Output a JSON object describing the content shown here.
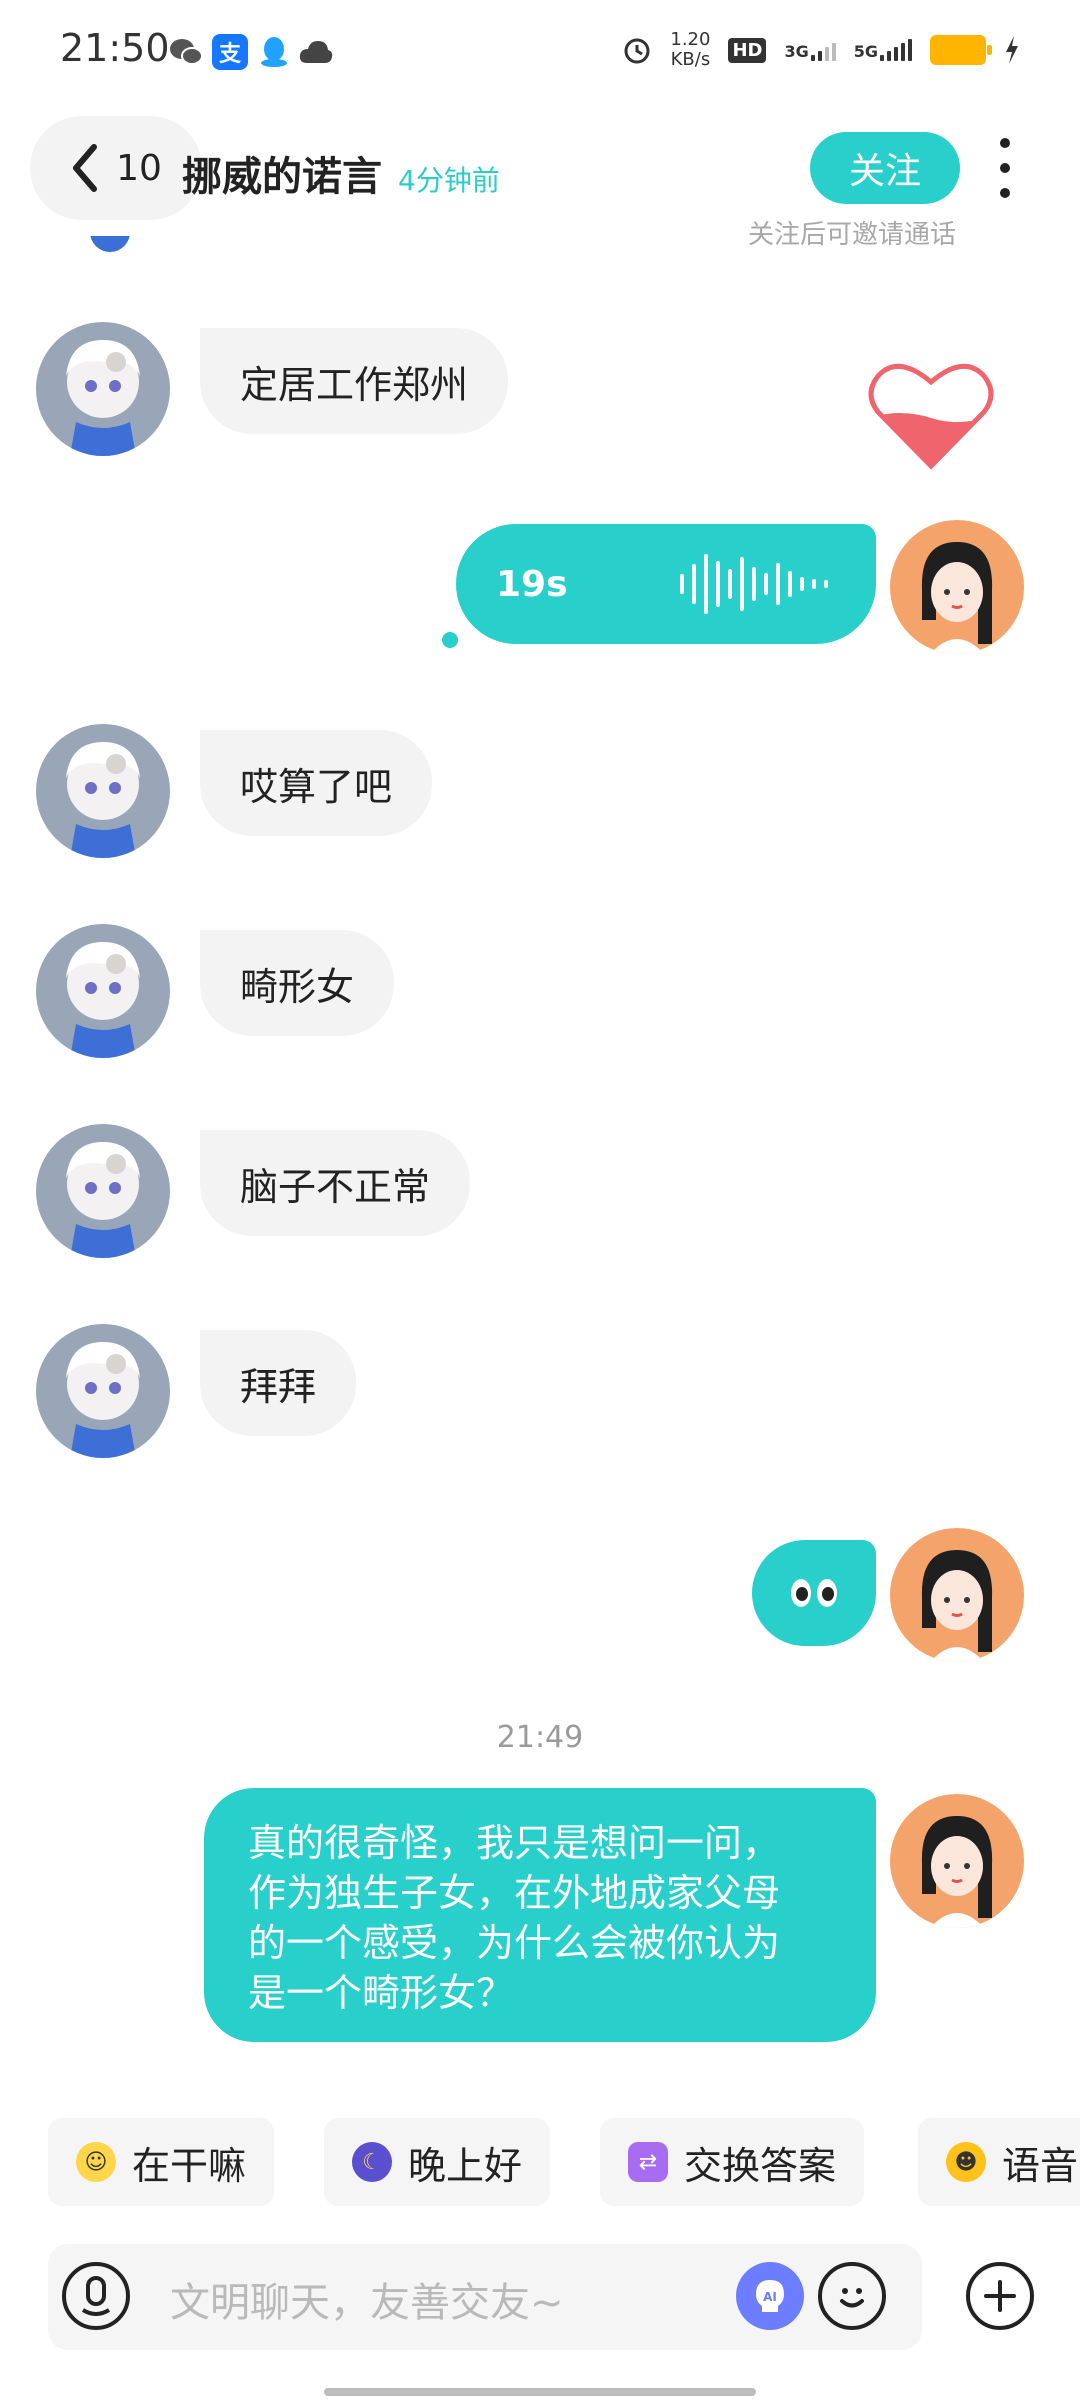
{
  "status_bar": {
    "time": "21:50",
    "net_speed": "1.20\nKB/s",
    "net_speed_top": "1.20",
    "net_speed_bottom": "KB/s",
    "hd_label": "HD",
    "sig1": "3G",
    "sig2": "5G",
    "app_icons": [
      "wechat-icon",
      "alipay-icon",
      "qq-icon",
      "cloud-icon"
    ],
    "alipay_char": "支"
  },
  "header": {
    "back_count": "10",
    "title": "挪威的诺言",
    "subtitle": "4分钟前",
    "follow_label": "关注",
    "follow_hint": "关注后可邀请通话"
  },
  "messages": [
    {
      "from": "other",
      "text": "定居工作郑州"
    },
    {
      "from": "me",
      "type": "voice",
      "duration": "19s"
    },
    {
      "from": "other",
      "text": "哎算了吧"
    },
    {
      "from": "other",
      "text": "畸形女"
    },
    {
      "from": "other",
      "text": "脑子不正常"
    },
    {
      "from": "other",
      "text": "拜拜"
    },
    {
      "from": "me",
      "type": "emoji",
      "emoji": "eyes"
    },
    {
      "from": "me",
      "text": "真的很奇怪，我只是想问一问，作为独生子女，在外地成家父母的一个感受，为什么会被你认为是一个畸形女？"
    }
  ],
  "timestamp": "21:49",
  "long_lines": [
    "真的很奇怪，我只是想问一问，",
    "作为独生子女，在外地成家父母",
    "的一个感受，为什么会被你认为",
    "是一个畸形女？"
  ],
  "chips": [
    "在干嘛",
    "晚上好",
    "交换答案",
    "语音"
  ],
  "input": {
    "placeholder": "文明聊天，友善交友~"
  },
  "colors": {
    "accent": "#28cfcb",
    "bubble_in": "#f3f3f3",
    "heart": "#f0646e"
  }
}
